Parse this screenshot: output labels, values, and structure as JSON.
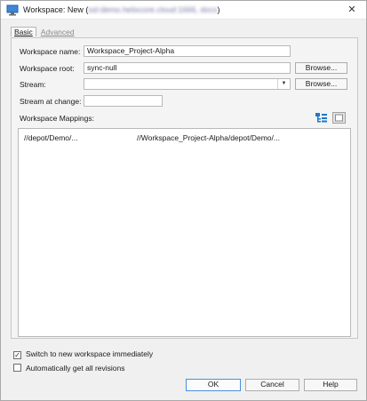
{
  "window": {
    "title_prefix": "Workspace: New (",
    "title_obscured": "ssl:demo.helixcore.cloud:1666, docs",
    "title_suffix": ")",
    "close_glyph": "✕"
  },
  "tabs": [
    {
      "label": "Basic",
      "active": true
    },
    {
      "label": "Advanced",
      "active": false
    }
  ],
  "form": {
    "workspace_name_label": "Workspace name:",
    "workspace_name_value": "Workspace_Project-Alpha",
    "workspace_root_label": "Workspace root:",
    "workspace_root_value": "sync-null",
    "browse_label": "Browse...",
    "stream_label": "Stream:",
    "stream_value": "",
    "stream_browse_label": "Browse...",
    "stream_at_change_label": "Stream at change:",
    "stream_at_change_value": "",
    "mappings_label": "Workspace Mappings:"
  },
  "mappings": [
    {
      "depot": "//depot/Demo/...",
      "workspace": "//Workspace_Project-Alpha/depot/Demo/..."
    }
  ],
  "options": {
    "switch_label": "Switch to new workspace immediately",
    "switch_checked": true,
    "auto_get_label": "Automatically get all revisions",
    "auto_get_checked": false
  },
  "buttons": {
    "ok": "OK",
    "cancel": "Cancel",
    "help": "Help"
  },
  "icons": {
    "title": "monitor-icon",
    "tree_view": "tree-view-icon",
    "text_view": "text-view-icon"
  },
  "colors": {
    "accent": "#4a90d9",
    "tree_icon": "#1f77c9"
  }
}
